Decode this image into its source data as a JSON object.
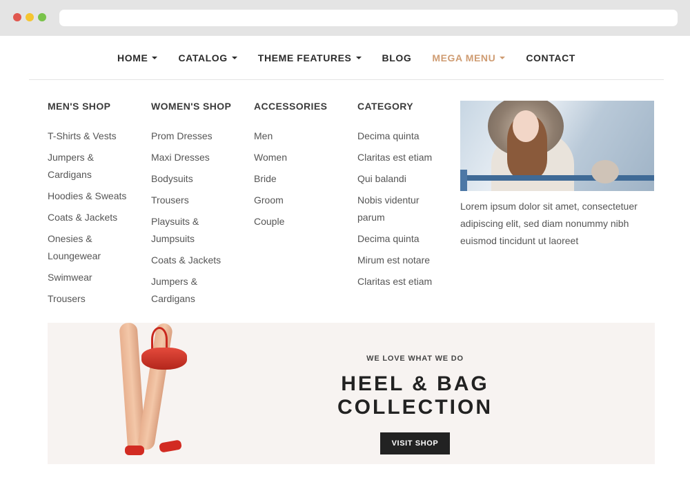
{
  "nav": {
    "items": [
      {
        "label": "HOME",
        "has_caret": true
      },
      {
        "label": "CATALOG",
        "has_caret": true
      },
      {
        "label": "THEME FEATURES",
        "has_caret": true
      },
      {
        "label": "BLOG",
        "has_caret": false
      },
      {
        "label": "MEGA MENU",
        "has_caret": true
      },
      {
        "label": "CONTACT",
        "has_caret": false
      }
    ],
    "active_color": "#cf9c72"
  },
  "mega": {
    "columns": [
      {
        "title": "MEN'S SHOP",
        "items": [
          "T-Shirts & Vests",
          "Jumpers & Cardigans",
          "Hoodies & Sweats",
          "Coats & Jackets",
          "Onesies & Loungewear",
          "Swimwear",
          "Trousers"
        ]
      },
      {
        "title": "WOMEN'S SHOP",
        "items": [
          "Prom Dresses",
          "Maxi Dresses",
          "Bodysuits",
          "Trousers",
          "Playsuits & Jumpsuits",
          "Coats & Jackets",
          "Jumpers & Cardigans"
        ]
      },
      {
        "title": "ACCESSORIES",
        "items": [
          "Men",
          "Women",
          "Bride",
          "Groom",
          "Couple"
        ]
      },
      {
        "title": "CATEGORY",
        "items": [
          "Decima quinta",
          "Claritas est etiam",
          "Qui balandi",
          "Nobis videntur parum",
          "Decima quinta",
          "Mirum est notare",
          "Claritas est etiam"
        ]
      }
    ],
    "feature_text": "Lorem ipsum dolor sit amet, consectetuer adipiscing elit, sed diam nonummy nibh euismod tincidunt ut laoreet"
  },
  "banner": {
    "tagline": "WE LOVE WHAT WE DO",
    "headline": "HEEL & BAG COLLECTION",
    "cta": "VISIT SHOP"
  },
  "chrome": {
    "dots": [
      "#e0574f",
      "#f5c531",
      "#79c34a"
    ]
  }
}
